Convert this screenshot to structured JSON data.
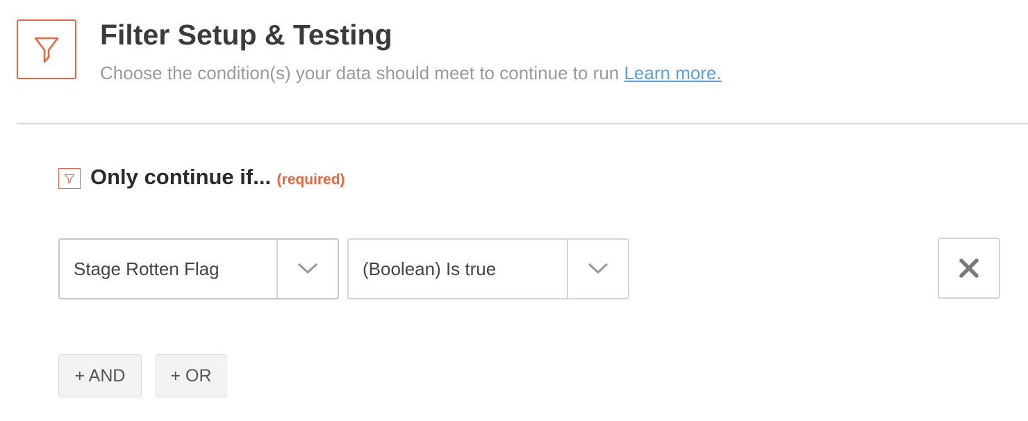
{
  "header": {
    "icon": "filter-icon",
    "title": "Filter Setup & Testing",
    "subtitle": "Choose the condition(s) your data should meet to continue to run",
    "learn_more_label": "Learn more."
  },
  "section": {
    "icon": "filter-icon",
    "title": "Only continue if...",
    "required_label": "(required)"
  },
  "condition_row": {
    "field_value": "Stage Rotten Flag",
    "operator_value": "(Boolean) Is true",
    "dropdown_icon": "chevron-down-icon",
    "remove_icon": "close-icon"
  },
  "logic_buttons": {
    "and_label": "+ AND",
    "or_label": "+ OR"
  },
  "colors": {
    "accent": "#e8653d",
    "link": "#5b9fe6",
    "title_text": "#3b3b3b",
    "subtitle_text": "#9a9a9a"
  }
}
